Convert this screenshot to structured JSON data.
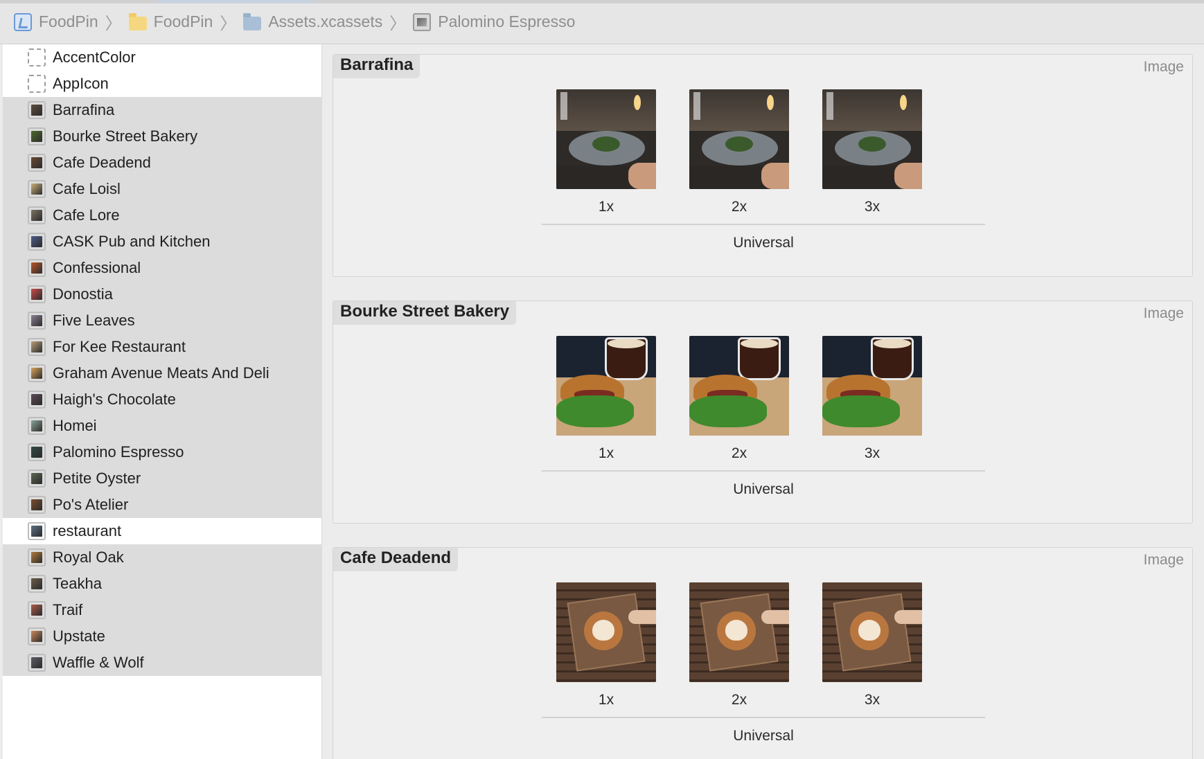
{
  "breadcrumb": [
    {
      "label": "FoodPin",
      "icon": "project-icon"
    },
    {
      "label": "FoodPin",
      "icon": "folder-icon"
    },
    {
      "label": "Assets.xcassets",
      "icon": "asset-catalog-icon"
    },
    {
      "label": "Palomino Espresso",
      "icon": "imageset-icon"
    }
  ],
  "sidebar": {
    "items": [
      {
        "label": "AccentColor",
        "icon": "color-set-icon",
        "selected": false,
        "thumb": "#ffffff"
      },
      {
        "label": "AppIcon",
        "icon": "app-icon-set-icon",
        "selected": false,
        "thumb": "#ffffff"
      },
      {
        "label": "Barrafina",
        "icon": "image-thumbnail-icon",
        "selected": true,
        "thumb": "#5c4c3f"
      },
      {
        "label": "Bourke Street Bakery",
        "icon": "image-thumbnail-icon",
        "selected": true,
        "thumb": "#4d6a2e"
      },
      {
        "label": "Cafe Deadend",
        "icon": "image-thumbnail-icon",
        "selected": true,
        "thumb": "#6b4a36"
      },
      {
        "label": "Cafe Loisl",
        "icon": "image-thumbnail-icon",
        "selected": true,
        "thumb": "#c8b07a"
      },
      {
        "label": "Cafe Lore",
        "icon": "image-thumbnail-icon",
        "selected": true,
        "thumb": "#7d7265"
      },
      {
        "label": "CASK Pub and Kitchen",
        "icon": "image-thumbnail-icon",
        "selected": true,
        "thumb": "#4e5c8a"
      },
      {
        "label": "Confessional",
        "icon": "image-thumbnail-icon",
        "selected": true,
        "thumb": "#b8542a"
      },
      {
        "label": "Donostia",
        "icon": "image-thumbnail-icon",
        "selected": true,
        "thumb": "#c94b4b"
      },
      {
        "label": "Five Leaves",
        "icon": "image-thumbnail-icon",
        "selected": true,
        "thumb": "#8a7f92"
      },
      {
        "label": "For Kee Restaurant",
        "icon": "image-thumbnail-icon",
        "selected": true,
        "thumb": "#b79e7a"
      },
      {
        "label": "Graham Avenue Meats And Deli",
        "icon": "image-thumbnail-icon",
        "selected": true,
        "thumb": "#d9a25a"
      },
      {
        "label": "Haigh's Chocolate",
        "icon": "image-thumbnail-icon",
        "selected": true,
        "thumb": "#5a4a55"
      },
      {
        "label": "Homei",
        "icon": "image-thumbnail-icon",
        "selected": true,
        "thumb": "#8aa396"
      },
      {
        "label": "Palomino Espresso",
        "icon": "image-thumbnail-icon",
        "selected": true,
        "thumb": "#2f4a44"
      },
      {
        "label": "Petite Oyster",
        "icon": "image-thumbnail-icon",
        "selected": true,
        "thumb": "#5a6652"
      },
      {
        "label": "Po's Atelier",
        "icon": "image-thumbnail-icon",
        "selected": true,
        "thumb": "#7a4d2e"
      },
      {
        "label": "restaurant",
        "icon": "image-thumbnail-icon",
        "selected": false,
        "thumb": "#5e6f84"
      },
      {
        "label": "Royal Oak",
        "icon": "image-thumbnail-icon",
        "selected": true,
        "thumb": "#b07a3c"
      },
      {
        "label": "Teakha",
        "icon": "image-thumbnail-icon",
        "selected": true,
        "thumb": "#6a5d4a"
      },
      {
        "label": "Traif",
        "icon": "image-thumbnail-icon",
        "selected": true,
        "thumb": "#a85a4a"
      },
      {
        "label": "Upstate",
        "icon": "image-thumbnail-icon",
        "selected": true,
        "thumb": "#c9885a"
      },
      {
        "label": "Waffle & Wolf",
        "icon": "image-thumbnail-icon",
        "selected": true,
        "thumb": "#5c5c66"
      }
    ]
  },
  "assets": [
    {
      "name": "Barrafina",
      "kind": "Image",
      "slots": [
        "1x",
        "2x",
        "3x"
      ],
      "device": "Universal",
      "image": "restaurant-table-photo"
    },
    {
      "name": "Bourke Street Bakery",
      "kind": "Image",
      "slots": [
        "1x",
        "2x",
        "3x"
      ],
      "device": "Universal",
      "image": "sandwich-and-coffee-photo"
    },
    {
      "name": "Cafe Deadend",
      "kind": "Image",
      "slots": [
        "1x",
        "2x",
        "3x"
      ],
      "device": "Universal",
      "image": "latte-art-photo"
    }
  ],
  "colors": {
    "selection": "#dcdcdc",
    "sidebar_bg": "#ffffff",
    "content_bg": "#ececec"
  }
}
